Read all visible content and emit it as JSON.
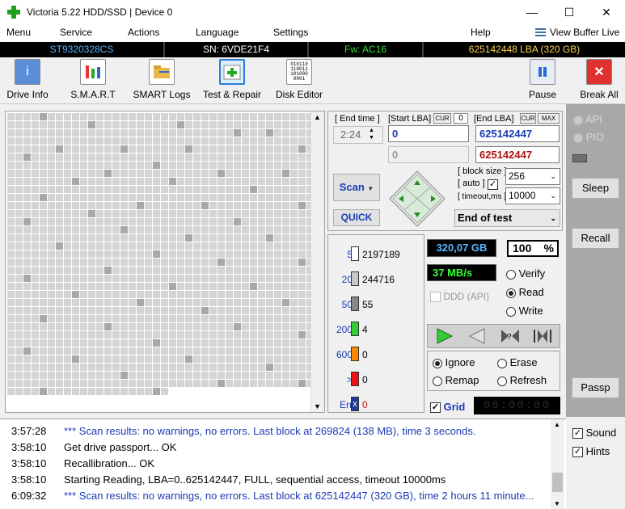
{
  "window": {
    "title": "Victoria 5.22 HDD/SSD | Device 0",
    "minimize": "—",
    "maximize": "☐",
    "close": "✕"
  },
  "menu": {
    "items": [
      "Menu",
      "Service",
      "Actions",
      "Language",
      "Settings",
      "Help"
    ],
    "view_buffer": "View Buffer Live"
  },
  "infobar": {
    "model": "ST9320328CS",
    "serial": "SN: 6VDE21F4",
    "firmware": "Fw: AC16",
    "capacity": "625142448 LBA (320 GB)"
  },
  "toolbar": {
    "drive_info": "Drive Info",
    "smart": "S.M.A.R.T",
    "smart_logs": "SMART Logs",
    "test_repair": "Test & Repair",
    "disk_editor": "Disk Editor",
    "pause": "Pause",
    "break_all": "Break All",
    "disk_editor_icon_text": "010110\n110011\n101000\n0001"
  },
  "scan": {
    "end_time_label": "[ End time ]",
    "end_time": "2:24",
    "start_lba_label": "[Start LBA]",
    "cur_label": "CUR",
    "cur_value": "0",
    "start_lba": "0",
    "start_lba2": "0",
    "end_lba_label": "[End LBA]",
    "cur2": "CUR",
    "max": "MAX",
    "end_lba": "625142447",
    "end_lba2": "625142447",
    "block_size_label": "[ block size ]",
    "auto_label": "[ auto ]",
    "timeout_label": "[ timeout,ms ]",
    "block_size": "256",
    "timeout": "10000",
    "scan_button": "Scan",
    "quick_button": "QUICK",
    "end_of_test": "End of test"
  },
  "stats": {
    "rows": [
      {
        "label": "5",
        "count": "2197189",
        "color": "#ffffff"
      },
      {
        "label": "20",
        "count": "244716",
        "color": "#c8c8c8"
      },
      {
        "label": "50",
        "count": "55",
        "color": "#888888"
      },
      {
        "label": "200",
        "count": "4",
        "color": "#33cc33"
      },
      {
        "label": "600",
        "count": "0",
        "color": "#ff8800"
      },
      {
        "label": ">",
        "count": "0",
        "color": "#ee1111"
      },
      {
        "label": "Err",
        "count": "0",
        "color": "#1e3c9c"
      }
    ],
    "err_mark": "x",
    "scanned": "320,07 GB",
    "percent": "100",
    "percent_sign": "%",
    "speed": "37 MB/s",
    "ddd": "DDD (API)",
    "verify": "Verify",
    "read": "Read",
    "write": "Write",
    "ignore": "Ignore",
    "erase": "Erase",
    "remap": "Remap",
    "refresh": "Refresh",
    "grid": "Grid",
    "grid_timer": "00:00:00"
  },
  "right": {
    "api": "API",
    "pio": "PIO",
    "sleep": "Sleep",
    "recall": "Recall",
    "passp": "Passp"
  },
  "log": [
    {
      "time": "3:57:28",
      "text": "*** Scan results: no warnings, no errors. Last block at 269824 (138 MB), time 3 seconds."
    },
    {
      "time": "3:58:10",
      "text": "Get drive passport... OK"
    },
    {
      "time": "3:58:10",
      "text": "Recallibration... OK"
    },
    {
      "time": "3:58:10",
      "text": "Starting Reading, LBA=0..625142447, FULL, sequential access, timeout 10000ms"
    },
    {
      "time": "6:09:32",
      "text": "*** Scan results: no warnings, no errors. Last block at 625142447 (320 GB), time 2 hours 11 minute..."
    }
  ],
  "options": {
    "sound": "Sound",
    "hints": "Hints"
  },
  "colors": {
    "accent_blue": "#1a3cb4",
    "green_display": "#33ff33",
    "blue_display": "#1e4fb4"
  },
  "map_grid": {
    "columns": 38,
    "rows": 36,
    "filled_cells": 1312,
    "dark_cells": [
      [
        4,
        0
      ],
      [
        10,
        1
      ],
      [
        21,
        1
      ],
      [
        28,
        2
      ],
      [
        32,
        2
      ],
      [
        6,
        4
      ],
      [
        14,
        4
      ],
      [
        22,
        4
      ],
      [
        36,
        4
      ],
      [
        2,
        5
      ],
      [
        18,
        6
      ],
      [
        12,
        7
      ],
      [
        26,
        7
      ],
      [
        34,
        7
      ],
      [
        8,
        8
      ],
      [
        20,
        8
      ],
      [
        30,
        9
      ],
      [
        4,
        10
      ],
      [
        16,
        11
      ],
      [
        24,
        11
      ],
      [
        36,
        11
      ],
      [
        10,
        12
      ],
      [
        2,
        13
      ],
      [
        28,
        13
      ],
      [
        14,
        14
      ],
      [
        22,
        15
      ],
      [
        32,
        15
      ],
      [
        6,
        16
      ],
      [
        18,
        17
      ],
      [
        26,
        18
      ],
      [
        36,
        18
      ],
      [
        12,
        19
      ],
      [
        2,
        20
      ],
      [
        20,
        21
      ],
      [
        30,
        21
      ],
      [
        8,
        22
      ],
      [
        16,
        23
      ],
      [
        34,
        23
      ],
      [
        24,
        24
      ],
      [
        4,
        25
      ],
      [
        12,
        26
      ],
      [
        28,
        26
      ],
      [
        36,
        27
      ],
      [
        18,
        28
      ],
      [
        2,
        29
      ],
      [
        22,
        30
      ],
      [
        8,
        30
      ],
      [
        32,
        31
      ],
      [
        14,
        32
      ],
      [
        26,
        33
      ],
      [
        36,
        33
      ],
      [
        4,
        34
      ],
      [
        18,
        34
      ],
      [
        10,
        35
      ],
      [
        30,
        35
      ]
    ]
  }
}
